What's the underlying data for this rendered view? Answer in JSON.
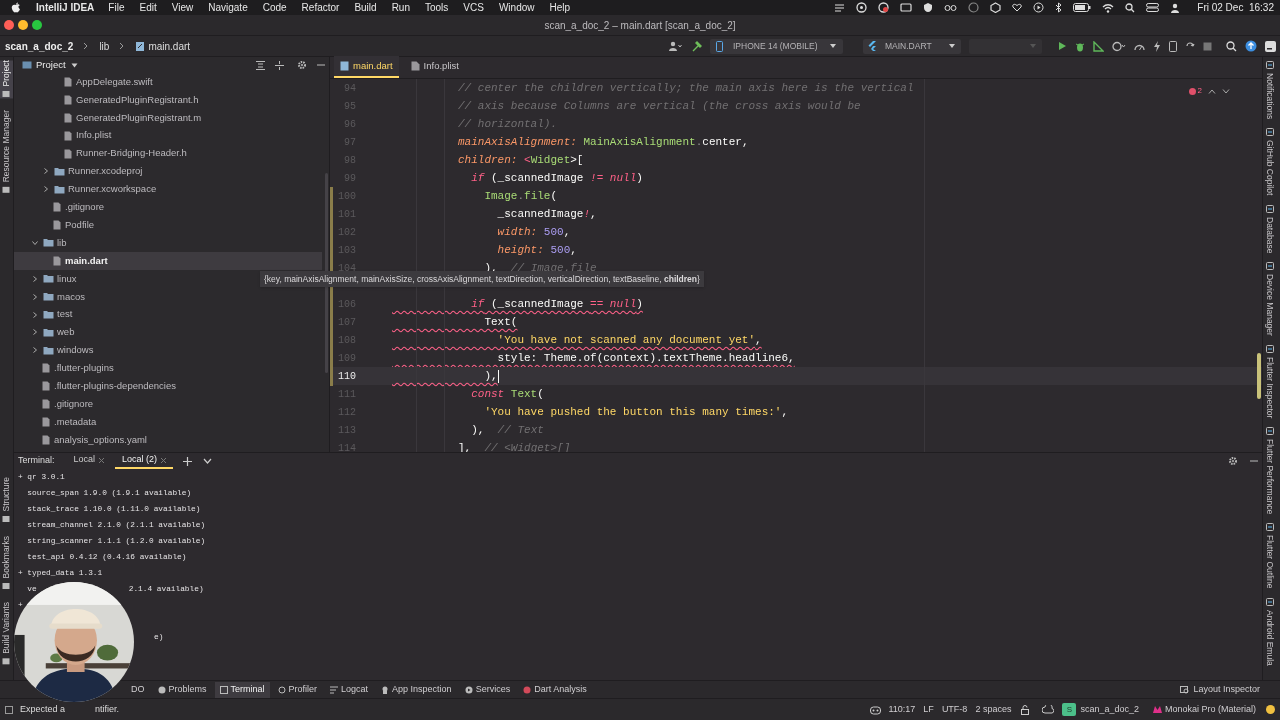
{
  "menu_bar": {
    "app": "IntelliJ IDEA",
    "items": [
      "File",
      "Edit",
      "View",
      "Navigate",
      "Code",
      "Refactor",
      "Build",
      "Run",
      "Tools",
      "VCS",
      "Window",
      "Help"
    ],
    "clock": "Fri 02 Dec  16:32"
  },
  "window": {
    "title": "scan_a_doc_2 – main.dart [scan_a_doc_2]"
  },
  "breadcrumb": [
    "scan_a_doc_2",
    "lib",
    "main.dart"
  ],
  "toolbar": {
    "device": "IPHONE 14 (MOBILE)",
    "config": "MAIN.DART",
    "third_dropdown": {
      "disabled": true
    }
  },
  "left_toolbar": {
    "top": [
      {
        "label": "Project",
        "selected": true
      },
      {
        "label": "Resource Manager",
        "selected": false
      }
    ],
    "bottom": [
      {
        "label": "Structure",
        "selected": false
      },
      {
        "label": "Bookmarks",
        "selected": false
      },
      {
        "label": "Build Variants",
        "selected": false
      }
    ]
  },
  "project_panel": {
    "title": "Project",
    "tree": [
      {
        "children": [
          {
            "children": [
              {
                "label": "AppDelegate.swift",
                "kind": "file",
                "selected": false
              },
              {
                "label": "GeneratedPluginRegistrant.h",
                "kind": "file",
                "selected": false
              },
              {
                "label": "GeneratedPluginRegistrant.m",
                "kind": "file",
                "selected": false
              },
              {
                "label": "Info.plist",
                "kind": "file",
                "selected": false
              },
              {
                "label": "Runner-Bridging-Header.h",
                "kind": "file",
                "selected": false
              }
            ]
          },
          {
            "label": "Runner.xcodeproj",
            "kind": "folder",
            "expanded": false,
            "selected": false
          },
          {
            "label": "Runner.xcworkspace",
            "kind": "folder",
            "expanded": false,
            "selected": false
          },
          {
            "label": ".gitignore",
            "kind": "file",
            "selected": false
          },
          {
            "label": "Podfile",
            "kind": "file",
            "selected": false
          }
        ]
      },
      {
        "label": "lib",
        "kind": "folder",
        "expanded": true,
        "selected": false,
        "children": [
          {
            "label": "main.dart",
            "kind": "file",
            "selected": true
          }
        ]
      },
      {
        "label": "linux",
        "kind": "folder",
        "expanded": false,
        "selected": false
      },
      {
        "label": "macos",
        "kind": "folder",
        "expanded": false,
        "selected": false
      },
      {
        "label": "test",
        "kind": "folder",
        "expanded": false,
        "selected": false
      },
      {
        "label": "web",
        "kind": "folder",
        "expanded": false,
        "selected": false
      },
      {
        "label": "windows",
        "kind": "folder",
        "expanded": false,
        "selected": false
      },
      {
        "label": ".flutter-plugins",
        "kind": "file",
        "selected": false
      },
      {
        "label": ".flutter-plugins-dependencies",
        "kind": "file",
        "selected": false
      },
      {
        "label": ".gitignore",
        "kind": "file",
        "selected": false
      },
      {
        "label": ".metadata",
        "kind": "file",
        "selected": false
      },
      {
        "label": "analysis_options.yaml",
        "kind": "file",
        "selected": false
      }
    ]
  },
  "editor": {
    "tabs": [
      {
        "label": "main.dart",
        "selected": true
      },
      {
        "label": "Info.plist",
        "selected": false
      }
    ],
    "problems": "2",
    "lines_above": [
      {
        "number": "94",
        "error": false,
        "current": false,
        "tokens": [
          {
            "text": "          // center the children vertically; the main axis here is the vertical",
            "kind": "comment"
          }
        ]
      },
      {
        "number": "95",
        "error": false,
        "current": false,
        "tokens": [
          {
            "text": "          // axis because Columns are vertical (the cross axis would be",
            "kind": "comment"
          }
        ]
      },
      {
        "number": "96",
        "error": false,
        "current": false,
        "tokens": [
          {
            "text": "          // horizontal).",
            "kind": "comment"
          }
        ]
      },
      {
        "number": "97",
        "error": false,
        "current": false,
        "tokens": [
          {
            "text": "          mainAxisAlignment:",
            "kind": "param"
          },
          {
            "text": " MainAxisAlignment",
            "kind": "type"
          },
          {
            "text": ".",
            "kind": "punct"
          },
          {
            "text": "center,",
            "kind": "plain"
          }
        ]
      },
      {
        "number": "98",
        "error": false,
        "current": false,
        "tokens": [
          {
            "text": "          children:",
            "kind": "param"
          },
          {
            "text": " <",
            "kind": "keyword"
          },
          {
            "text": "Widget",
            "kind": "type"
          },
          {
            "text": ">[",
            "kind": "plain"
          }
        ]
      },
      {
        "number": "99",
        "error": false,
        "current": false,
        "tokens": [
          {
            "text": "            if",
            "kind": "keyword"
          },
          {
            "text": " (_scannedImage ",
            "kind": "plain"
          },
          {
            "text": "!= null",
            "kind": "keyword"
          },
          {
            "text": ")",
            "kind": "plain"
          }
        ]
      },
      {
        "number": "100",
        "error": false,
        "current": false,
        "tokens": [
          {
            "text": "              Image",
            "kind": "type"
          },
          {
            "text": ".",
            "kind": "punct"
          },
          {
            "text": "file",
            "kind": "type"
          },
          {
            "text": "(",
            "kind": "plain"
          }
        ]
      },
      {
        "number": "101",
        "error": false,
        "current": false,
        "tokens": [
          {
            "text": "                _scannedImage",
            "kind": "plain"
          },
          {
            "text": "!",
            "kind": "keyword"
          },
          {
            "text": ",",
            "kind": "plain"
          }
        ]
      },
      {
        "number": "102",
        "error": false,
        "current": false,
        "tokens": [
          {
            "text": "                width:",
            "kind": "param"
          },
          {
            "text": " 500",
            "kind": "number"
          },
          {
            "text": ",",
            "kind": "plain"
          }
        ]
      },
      {
        "number": "103",
        "error": false,
        "current": false,
        "tokens": [
          {
            "text": "                height:",
            "kind": "param"
          },
          {
            "text": " 500",
            "kind": "number"
          },
          {
            "text": ",",
            "kind": "plain"
          }
        ]
      },
      {
        "number": "104",
        "error": false,
        "current": false,
        "tokens": [
          {
            "text": "              ),",
            "kind": "plain"
          },
          {
            "text": "  // Image.file",
            "kind": "comment"
          }
        ]
      }
    ],
    "lines_below": [
      {
        "number": "106",
        "error": true,
        "current": false,
        "tokens": [
          {
            "text": "            if",
            "kind": "keyword"
          },
          {
            "text": " (_scannedImage ",
            "kind": "plain"
          },
          {
            "text": "== null",
            "kind": "keyword"
          },
          {
            "text": ")",
            "kind": "plain"
          }
        ]
      },
      {
        "number": "107",
        "error": true,
        "current": false,
        "tokens": [
          {
            "text": "              Text(",
            "kind": "plain"
          }
        ]
      },
      {
        "number": "108",
        "error": true,
        "current": false,
        "tokens": [
          {
            "text": "                'You have not scanned any document yet'",
            "kind": "string"
          },
          {
            "text": ",",
            "kind": "plain"
          }
        ]
      },
      {
        "number": "109",
        "error": true,
        "current": false,
        "tokens": [
          {
            "text": "                style: Theme.of(context).textTheme.headline6,",
            "kind": "plain"
          }
        ]
      },
      {
        "number": "110",
        "error": true,
        "current": true,
        "tokens": [
          {
            "text": "              ),",
            "kind": "plain"
          }
        ]
      },
      {
        "number": "111",
        "error": false,
        "current": false,
        "tokens": [
          {
            "text": "            const",
            "kind": "keyword"
          },
          {
            "text": " Text",
            "kind": "type"
          },
          {
            "text": "(",
            "kind": "plain"
          }
        ]
      },
      {
        "number": "112",
        "error": false,
        "current": false,
        "tokens": [
          {
            "text": "              'You have pushed the button this many times:'",
            "kind": "string"
          },
          {
            "text": ",",
            "kind": "plain"
          }
        ]
      },
      {
        "number": "113",
        "error": false,
        "current": false,
        "tokens": [
          {
            "text": "            ),",
            "kind": "plain"
          },
          {
            "text": "  // Text",
            "kind": "comment"
          }
        ]
      },
      {
        "number": "114",
        "error": false,
        "current": false,
        "tokens": [
          {
            "text": "          ],",
            "kind": "plain"
          },
          {
            "text": "  // <Widget>[]",
            "kind": "comment"
          }
        ]
      }
    ],
    "tooltip": "{key, mainAxisAlignment, mainAxisSize, crossAxisAlignment, textDirection, verticalDirection, textBaseline, **children**}"
  },
  "right_toolbar": [
    {
      "label": "Notifications"
    },
    {
      "label": "GitHub Copilot"
    },
    {
      "label": "Database"
    },
    {
      "label": "Device Manager"
    },
    {
      "label": "Flutter Inspector"
    },
    {
      "label": "Flutter Performance"
    },
    {
      "label": "Flutter Outline"
    },
    {
      "label": "Android Emula"
    }
  ],
  "terminal": {
    "label": "Terminal:",
    "tabs": [
      {
        "label": "Local",
        "selected": false
      },
      {
        "label": "Local (2)",
        "selected": true
      }
    ],
    "lines": [
      {
        "kind": "full",
        "text": "+ qr 3.0.1"
      },
      {
        "kind": "full",
        "text": "  source_span 1.9.0 (1.9.1 available)"
      },
      {
        "kind": "full",
        "text": "  stack_trace 1.10.0 (1.11.0 available)"
      },
      {
        "kind": "full",
        "text": "  stream_channel 2.1.0 (2.1.1 available)"
      },
      {
        "kind": "full",
        "text": "  string_scanner 1.1.1 (1.2.0 available)"
      },
      {
        "kind": "full",
        "text": "  test_api 0.4.12 (0.4.16 available)"
      },
      {
        "kind": "full",
        "text": "+ typed_data 1.3.1"
      },
      {
        "kind": "split",
        "parts": [
          "  ve",
          "2.1.4 available)"
        ]
      },
      {
        "kind": "full",
        "text": "+"
      },
      {
        "kind": "tail",
        "text": "e)"
      }
    ]
  },
  "tool_windows": [
    {
      "label": "DO",
      "selected": false
    },
    {
      "label": "Problems",
      "selected": false
    },
    {
      "label": "Terminal",
      "selected": true
    },
    {
      "label": "Profiler",
      "selected": false
    },
    {
      "label": "Logcat",
      "selected": false
    },
    {
      "label": "App Inspection",
      "selected": false
    },
    {
      "label": "Services",
      "selected": false
    },
    {
      "label": "Dart Analysis",
      "selected": false
    }
  ],
  "layout_inspector": "Layout Inspector",
  "status_bar": {
    "message_parts": [
      "Expected a",
      "ntifier."
    ],
    "position": "110:17",
    "line_separator": "LF",
    "encoding": "UTF-8",
    "indent": "2 spaces",
    "project_badge": "S",
    "project": "scan_a_doc_2",
    "theme": "Monokai Pro (Material)"
  }
}
